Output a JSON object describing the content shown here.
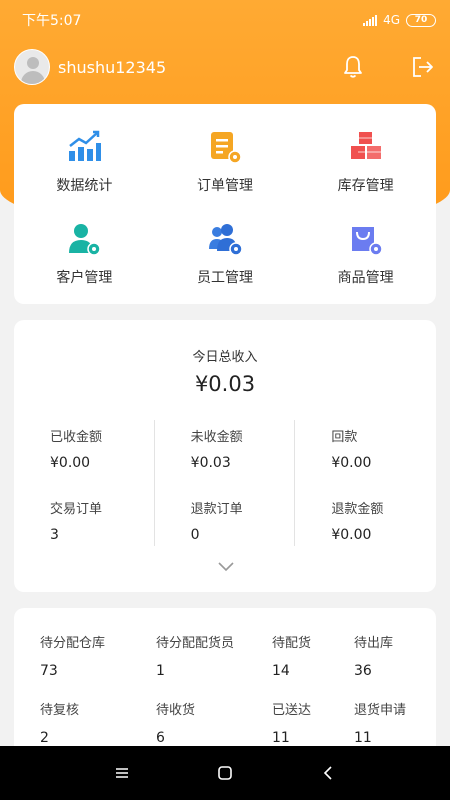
{
  "status_bar": {
    "time": "下午5:07",
    "network": "4G",
    "battery": "70"
  },
  "header": {
    "username": "shushu12345"
  },
  "menu": [
    {
      "label": "数据统计",
      "icon": "chart-icon"
    },
    {
      "label": "订单管理",
      "icon": "order-icon"
    },
    {
      "label": "库存管理",
      "icon": "inventory-icon"
    },
    {
      "label": "客户管理",
      "icon": "customer-icon"
    },
    {
      "label": "员工管理",
      "icon": "staff-icon"
    },
    {
      "label": "商品管理",
      "icon": "product-icon"
    }
  ],
  "income": {
    "title": "今日总收入",
    "total": "¥0.03",
    "stats": [
      {
        "label": "已收金额",
        "value": "¥0.00"
      },
      {
        "label": "未收金额",
        "value": "¥0.03"
      },
      {
        "label": "回款",
        "value": "¥0.00"
      },
      {
        "label": "交易订单",
        "value": "3"
      },
      {
        "label": "退款订单",
        "value": "0"
      },
      {
        "label": "退款金额",
        "value": "¥0.00"
      }
    ]
  },
  "orders": [
    {
      "label": "待分配仓库",
      "value": "73"
    },
    {
      "label": "待分配配货员",
      "value": "1"
    },
    {
      "label": "待配货",
      "value": "14"
    },
    {
      "label": "待出库",
      "value": "36"
    },
    {
      "label": "待复核",
      "value": "2"
    },
    {
      "label": "待收货",
      "value": "6"
    },
    {
      "label": "已送达",
      "value": "11"
    },
    {
      "label": "退货申请",
      "value": "11"
    }
  ],
  "colors": {
    "accent": "#ff9a1a",
    "blue": "#2f8fe8",
    "orange": "#f5a623",
    "red": "#f0504f"
  }
}
